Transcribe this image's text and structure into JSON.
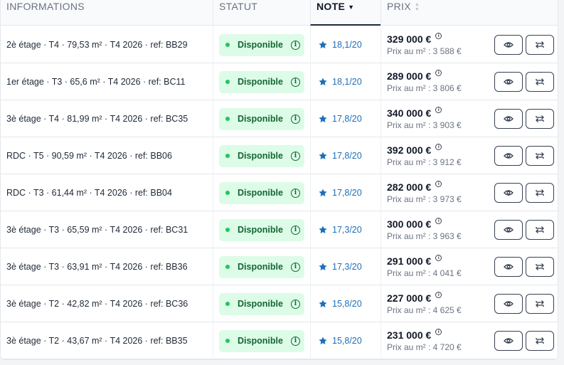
{
  "header": {
    "informations": "INFORMATIONS",
    "statut": "STATUT",
    "note": "NOTE",
    "prix": "PRIX"
  },
  "icons": {
    "sort_active": "caret-down-icon",
    "sort_inactive": "sort-icon",
    "star": "star-icon",
    "info": "info-icon",
    "view": "eye-icon",
    "compare": "swap-icon"
  },
  "colors": {
    "badge_bg": "#dcfce7",
    "badge_text": "#166534",
    "note_text": "#1d6fb8",
    "star": "#1d6fb8"
  },
  "rows": [
    {
      "info": "2è étage · T4 · 79,53 m² · T4 2026 · ref: BB29",
      "status": "Disponible",
      "note": "18,1/20",
      "price": "329 000 €",
      "price_m2": "Prix au m² : 3 588 €"
    },
    {
      "info": "1er étage · T3 · 65,6 m² · T4 2026 · ref: BC11",
      "status": "Disponible",
      "note": "18,1/20",
      "price": "289 000 €",
      "price_m2": "Prix au m² : 3 806 €"
    },
    {
      "info": "3è étage · T4 · 81,99 m² · T4 2026 · ref: BC35",
      "status": "Disponible",
      "note": "17,8/20",
      "price": "340 000 €",
      "price_m2": "Prix au m² : 3 903 €"
    },
    {
      "info": "RDC · T5 · 90,59 m² · T4 2026 · ref: BB06",
      "status": "Disponible",
      "note": "17,8/20",
      "price": "392 000 €",
      "price_m2": "Prix au m² : 3 912 €"
    },
    {
      "info": "RDC · T3 · 61,44 m² · T4 2026 · ref: BB04",
      "status": "Disponible",
      "note": "17,8/20",
      "price": "282 000 €",
      "price_m2": "Prix au m² : 3 973 €"
    },
    {
      "info": "3è étage · T3 · 65,59 m² · T4 2026 · ref: BC31",
      "status": "Disponible",
      "note": "17,3/20",
      "price": "300 000 €",
      "price_m2": "Prix au m² : 3 963 €"
    },
    {
      "info": "3è étage · T3 · 63,91 m² · T4 2026 · ref: BB36",
      "status": "Disponible",
      "note": "17,3/20",
      "price": "291 000 €",
      "price_m2": "Prix au m² : 4 041 €"
    },
    {
      "info": "3è étage · T2 · 42,82 m² · T4 2026 · ref: BC36",
      "status": "Disponible",
      "note": "15,8/20",
      "price": "227 000 €",
      "price_m2": "Prix au m² : 4 625 €"
    },
    {
      "info": "3è étage · T2 · 43,67 m² · T4 2026 · ref: BB35",
      "status": "Disponible",
      "note": "15,8/20",
      "price": "231 000 €",
      "price_m2": "Prix au m² : 4 720 €"
    }
  ]
}
